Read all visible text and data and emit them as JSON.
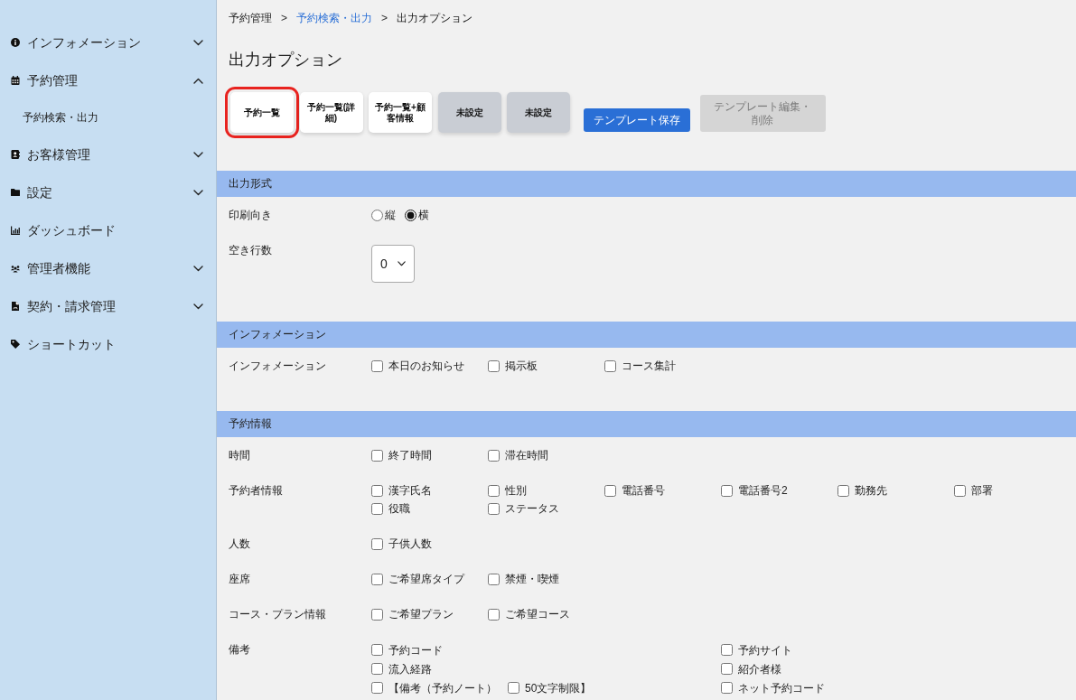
{
  "sidebar": {
    "items": [
      {
        "label": "インフォメーション",
        "expanded": false
      },
      {
        "label": "予約管理",
        "expanded": true,
        "children": [
          {
            "label": "予約検索・出力"
          }
        ]
      },
      {
        "label": "お客様管理",
        "expanded": false
      },
      {
        "label": "設定",
        "expanded": false
      },
      {
        "label": "ダッシュボード"
      },
      {
        "label": "管理者機能",
        "expanded": false
      },
      {
        "label": "契約・請求管理",
        "expanded": false
      },
      {
        "label": "ショートカット"
      }
    ]
  },
  "breadcrumb": [
    {
      "label": "予約管理",
      "link": false
    },
    {
      "separator": ">",
      "label": "予約検索・出力",
      "link": true
    },
    {
      "separator": ">",
      "label": "出力オプション",
      "link": false
    }
  ],
  "page_title": "出力オプション",
  "template_buttons": [
    {
      "label": "予約一覧",
      "configured": true,
      "selected": true
    },
    {
      "label": "予約一覧(詳細)",
      "configured": true,
      "selected": false
    },
    {
      "label": "予約一覧+顧客情報",
      "configured": true,
      "selected": false
    },
    {
      "label": "未設定",
      "configured": false,
      "selected": false
    },
    {
      "label": "未設定",
      "configured": false,
      "selected": false
    }
  ],
  "actions": [
    {
      "label": "テンプレート保存",
      "disabled": false
    },
    {
      "label": "テンプレート編集・削除",
      "disabled": true
    }
  ],
  "sections": [
    {
      "title": "出力形式",
      "fields": [
        {
          "kind": "radio",
          "label": "印刷向き",
          "options": [
            {
              "label": "縦",
              "selected": false
            },
            {
              "label": "横",
              "selected": true
            }
          ]
        },
        {
          "kind": "select",
          "label": "空き行数",
          "value": "0"
        }
      ]
    },
    {
      "title": "インフォメーション",
      "fields": [
        {
          "kind": "checkboxes",
          "label": "インフォメーション",
          "options": [
            {
              "label": "本日のお知らせ",
              "checked": false
            },
            {
              "label": "掲示板",
              "checked": false
            },
            {
              "label": "コース集計",
              "checked": false
            }
          ]
        }
      ]
    },
    {
      "title": "予約情報",
      "fields": [
        {
          "kind": "checkboxes",
          "label": "時間",
          "options": [
            {
              "label": "終了時間",
              "checked": false
            },
            {
              "label": "滞在時間",
              "checked": false
            }
          ]
        },
        {
          "kind": "checkboxes",
          "label": "予約者情報",
          "options": [
            {
              "label": "漢字氏名",
              "checked": false
            },
            {
              "label": "性別",
              "checked": false
            },
            {
              "label": "電話番号",
              "checked": false
            },
            {
              "label": "電話番号2",
              "checked": false
            },
            {
              "label": "勤務先",
              "checked": false
            },
            {
              "label": "部署",
              "checked": false
            },
            {
              "label": "役職",
              "checked": false
            },
            {
              "label": "ステータス",
              "checked": false
            }
          ]
        },
        {
          "kind": "checkboxes",
          "label": "人数",
          "options": [
            {
              "label": "子供人数",
              "checked": false
            }
          ]
        },
        {
          "kind": "checkboxes",
          "label": "座席",
          "options": [
            {
              "label": "ご希望席タイプ",
              "checked": false
            },
            {
              "label": "禁煙・喫煙",
              "checked": false
            }
          ]
        },
        {
          "kind": "checkboxes",
          "label": "コース・プラン情報",
          "options": [
            {
              "label": "ご希望プラン",
              "checked": false
            },
            {
              "label": "ご希望コース",
              "checked": false
            }
          ]
        },
        {
          "kind": "checkbox_columns",
          "label": "備考",
          "columns": [
            {
              "lines": [
                {
                  "options": [
                    {
                      "label": "予約コード",
                      "checked": false
                    }
                  ]
                },
                {
                  "options": [
                    {
                      "label": "流入経路",
                      "checked": false
                    }
                  ]
                },
                {
                  "options": [
                    {
                      "label": "【備考（予約ノート）",
                      "checked": false
                    },
                    {
                      "label": "50文字制限】",
                      "checked": false
                    }
                  ]
                }
              ]
            },
            {
              "lines": [
                {
                  "options": [
                    {
                      "label": "予約サイト",
                      "checked": false
                    }
                  ]
                },
                {
                  "options": [
                    {
                      "label": "紹介者様",
                      "checked": false
                    }
                  ]
                },
                {
                  "options": [
                    {
                      "label": "ネット予約コード",
                      "checked": false
                    }
                  ]
                }
              ]
            }
          ]
        }
      ]
    }
  ]
}
